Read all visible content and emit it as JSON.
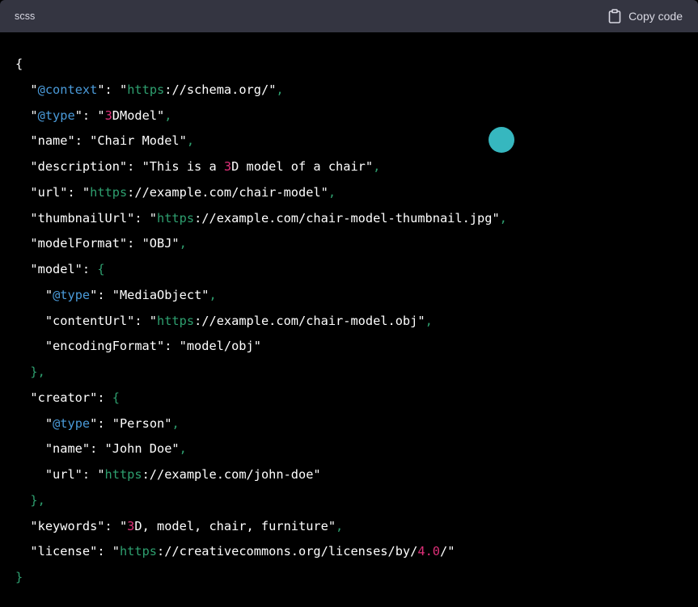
{
  "header": {
    "language": "scss",
    "copy_label": "Copy code",
    "copy_icon": "clipboard-icon"
  },
  "colors": {
    "background": "#000000",
    "header_bg": "#343541",
    "header_text": "#d9d9e3",
    "string_green": "#2e9f6f",
    "at_blue": "#4a9ad9",
    "number_pink": "#df3079",
    "cursor_teal": "#36b7bf"
  },
  "code_lines": [
    [
      {
        "t": "{",
        "c": "punct"
      }
    ],
    [
      {
        "t": "  \"",
        "c": "q"
      },
      {
        "t": "@context",
        "c": "at"
      },
      {
        "t": "\"",
        "c": "q"
      },
      {
        "t": ": ",
        "c": "punct"
      },
      {
        "t": "\"",
        "c": "q"
      },
      {
        "t": "https",
        "c": "proto"
      },
      {
        "t": "://schema.org/",
        "c": "str"
      },
      {
        "t": "\"",
        "c": "q"
      },
      {
        "t": ",",
        "c": "punct-g"
      }
    ],
    [
      {
        "t": "  \"",
        "c": "q"
      },
      {
        "t": "@type",
        "c": "at"
      },
      {
        "t": "\"",
        "c": "q"
      },
      {
        "t": ": ",
        "c": "punct"
      },
      {
        "t": "\"",
        "c": "q"
      },
      {
        "t": "3",
        "c": "num"
      },
      {
        "t": "DModel",
        "c": "str"
      },
      {
        "t": "\"",
        "c": "q"
      },
      {
        "t": ",",
        "c": "punct-g"
      }
    ],
    [
      {
        "t": "  \"name\"",
        "c": "key"
      },
      {
        "t": ": ",
        "c": "punct"
      },
      {
        "t": "\"Chair Model\"",
        "c": "str"
      },
      {
        "t": ",",
        "c": "punct-g"
      }
    ],
    [
      {
        "t": "  \"description\"",
        "c": "key"
      },
      {
        "t": ": ",
        "c": "punct"
      },
      {
        "t": "\"This is a ",
        "c": "str"
      },
      {
        "t": "3",
        "c": "num"
      },
      {
        "t": "D model of a chair\"",
        "c": "str"
      },
      {
        "t": ",",
        "c": "punct-g"
      }
    ],
    [
      {
        "t": "  \"url\"",
        "c": "key"
      },
      {
        "t": ": ",
        "c": "punct"
      },
      {
        "t": "\"",
        "c": "q"
      },
      {
        "t": "https",
        "c": "proto"
      },
      {
        "t": "://example.com/chair-model\"",
        "c": "str"
      },
      {
        "t": ",",
        "c": "punct-g"
      }
    ],
    [
      {
        "t": "  \"thumbnailUrl\"",
        "c": "key"
      },
      {
        "t": ": ",
        "c": "punct"
      },
      {
        "t": "\"",
        "c": "q"
      },
      {
        "t": "https",
        "c": "proto"
      },
      {
        "t": "://example.com/chair-model-thumbnail.jpg\"",
        "c": "str"
      },
      {
        "t": ",",
        "c": "punct-g"
      }
    ],
    [
      {
        "t": "  \"modelFormat\"",
        "c": "key"
      },
      {
        "t": ": ",
        "c": "punct"
      },
      {
        "t": "\"OBJ\"",
        "c": "str"
      },
      {
        "t": ",",
        "c": "punct-g"
      }
    ],
    [
      {
        "t": "  \"model\"",
        "c": "key"
      },
      {
        "t": ": ",
        "c": "punct"
      },
      {
        "t": "{",
        "c": "punct-g"
      }
    ],
    [
      {
        "t": "    \"",
        "c": "q"
      },
      {
        "t": "@type",
        "c": "at"
      },
      {
        "t": "\"",
        "c": "q"
      },
      {
        "t": ": ",
        "c": "punct"
      },
      {
        "t": "\"MediaObject\"",
        "c": "str"
      },
      {
        "t": ",",
        "c": "punct-g"
      }
    ],
    [
      {
        "t": "    \"contentUrl\"",
        "c": "key"
      },
      {
        "t": ": ",
        "c": "punct"
      },
      {
        "t": "\"",
        "c": "q"
      },
      {
        "t": "https",
        "c": "proto"
      },
      {
        "t": "://example.com/chair-model.obj\"",
        "c": "str"
      },
      {
        "t": ",",
        "c": "punct-g"
      }
    ],
    [
      {
        "t": "    \"encodingFormat\"",
        "c": "key"
      },
      {
        "t": ": ",
        "c": "punct"
      },
      {
        "t": "\"model/obj\"",
        "c": "str"
      }
    ],
    [
      {
        "t": "  },",
        "c": "punct-g"
      }
    ],
    [
      {
        "t": "  \"creator\"",
        "c": "key"
      },
      {
        "t": ": ",
        "c": "punct"
      },
      {
        "t": "{",
        "c": "punct-g"
      }
    ],
    [
      {
        "t": "    \"",
        "c": "q"
      },
      {
        "t": "@type",
        "c": "at"
      },
      {
        "t": "\"",
        "c": "q"
      },
      {
        "t": ": ",
        "c": "punct"
      },
      {
        "t": "\"Person\"",
        "c": "str"
      },
      {
        "t": ",",
        "c": "punct-g"
      }
    ],
    [
      {
        "t": "    \"name\"",
        "c": "key"
      },
      {
        "t": ": ",
        "c": "punct"
      },
      {
        "t": "\"John Doe\"",
        "c": "str"
      },
      {
        "t": ",",
        "c": "punct-g"
      }
    ],
    [
      {
        "t": "    \"url\"",
        "c": "key"
      },
      {
        "t": ": ",
        "c": "punct"
      },
      {
        "t": "\"",
        "c": "q"
      },
      {
        "t": "https",
        "c": "proto"
      },
      {
        "t": "://example.com/john-doe\"",
        "c": "str"
      }
    ],
    [
      {
        "t": "  },",
        "c": "punct-g"
      }
    ],
    [
      {
        "t": "  \"keywords\"",
        "c": "key"
      },
      {
        "t": ": ",
        "c": "punct"
      },
      {
        "t": "\"",
        "c": "q"
      },
      {
        "t": "3",
        "c": "num"
      },
      {
        "t": "D, model, chair, furniture\"",
        "c": "str"
      },
      {
        "t": ",",
        "c": "punct-g"
      }
    ],
    [
      {
        "t": "  \"license\"",
        "c": "key"
      },
      {
        "t": ": ",
        "c": "punct"
      },
      {
        "t": "\"",
        "c": "q"
      },
      {
        "t": "https",
        "c": "proto"
      },
      {
        "t": "://creativecommons.org/licenses/by/",
        "c": "str"
      },
      {
        "t": "4.0",
        "c": "num"
      },
      {
        "t": "/\"",
        "c": "str"
      }
    ],
    [
      {
        "t": "}",
        "c": "punct-g"
      }
    ]
  ]
}
